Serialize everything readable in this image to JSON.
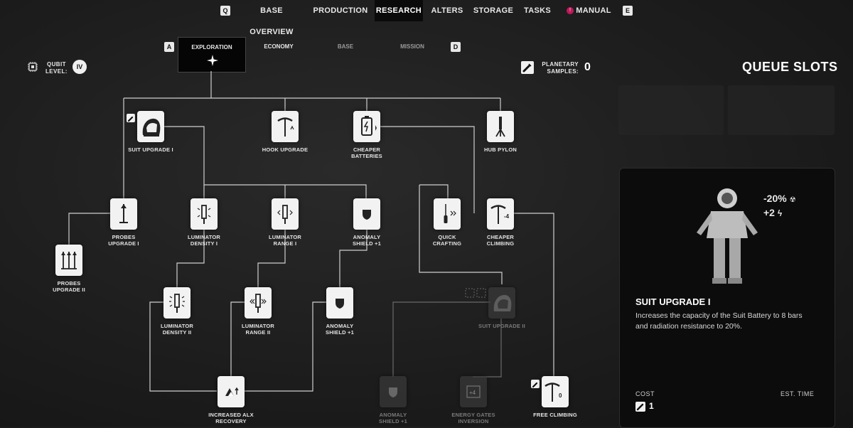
{
  "nav": {
    "key_left": "Q",
    "key_right": "E",
    "items": [
      {
        "label": "BASE OVERVIEW"
      },
      {
        "label": "PRODUCTION"
      },
      {
        "label": "RESEARCH"
      },
      {
        "label": "ALTERS"
      },
      {
        "label": "STORAGE"
      },
      {
        "label": "TASKS"
      },
      {
        "label": "MANUAL"
      }
    ],
    "manual_badge": "!",
    "active_index": 2
  },
  "categories": {
    "key_left": "A",
    "key_right": "D",
    "tabs": [
      {
        "label": "EXPLORATION"
      },
      {
        "label": "ECONOMY"
      },
      {
        "label": "BASE"
      },
      {
        "label": "MISSION"
      }
    ]
  },
  "qubit": {
    "label_line1": "QUBIT",
    "label_line2": "LEVEL:",
    "value": "IV"
  },
  "samples": {
    "label_line1": "PLANETARY",
    "label_line2": "SAMPLES:",
    "value": "0"
  },
  "queue": {
    "title": "QUEUE SLOTS"
  },
  "nodes": {
    "suit1": {
      "label": "SUIT UPGRADE I"
    },
    "hook": {
      "label": "HOOK UPGRADE"
    },
    "batteries": {
      "label_1": "CHEAPER",
      "label_2": "BATTERIES"
    },
    "pylon": {
      "label": "HUB PYLON"
    },
    "probes1": {
      "label_1": "PROBES",
      "label_2": "UPGRADE I"
    },
    "probes2": {
      "label_1": "PROBES",
      "label_2": "UPGRADE II"
    },
    "lumdens1": {
      "label_1": "LUMINATOR",
      "label_2": "DENSITY I"
    },
    "lumrange1": {
      "label_1": "LUMINATOR",
      "label_2": "RANGE I"
    },
    "shield1a": {
      "label_1": "ANOMALY",
      "label_2": "SHIELD +1"
    },
    "quickcraft": {
      "label_1": "QUICK",
      "label_2": "CRAFTING"
    },
    "climbing": {
      "label_1": "CHEAPER",
      "label_2": "CLIMBING"
    },
    "lumdens2": {
      "label_1": "LUMINATOR",
      "label_2": "DENSITY II"
    },
    "lumrange2": {
      "label_1": "LUMINATOR",
      "label_2": "RANGE II"
    },
    "shield1b": {
      "label_1": "ANOMALY",
      "label_2": "SHIELD +1"
    },
    "suit2": {
      "label": "SUIT UPGRADE II"
    },
    "alx": {
      "label_1": "INCREASED ALX",
      "label_2": "RECOVERY"
    },
    "shield1c": {
      "label_1": "ANOMALY",
      "label_2": "SHIELD +1"
    },
    "energy": {
      "label_1": "ENERGY GATES",
      "label_2": "INVERSION"
    },
    "freeclimb": {
      "label": "FREE CLIMBING"
    }
  },
  "detail": {
    "title": "SUIT UPGRADE I",
    "description": "Increases the capacity of the Suit Battery to 8 bars and radiation resistance to 20%.",
    "stat_radiation": "-20%",
    "stat_battery": "+2",
    "cost_label": "COST",
    "cost_value": "1",
    "time_label": "EST. TIME"
  }
}
